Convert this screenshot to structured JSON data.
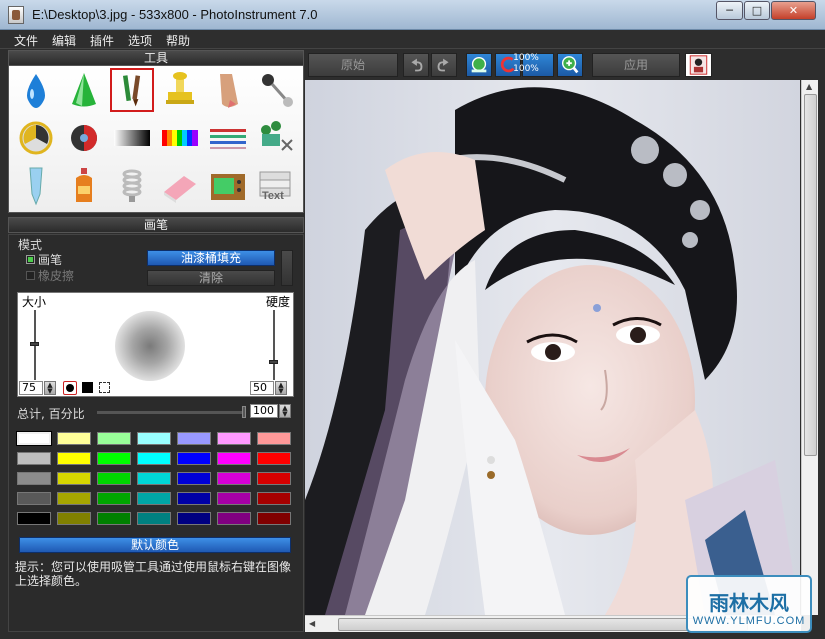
{
  "window": {
    "title": "E:\\Desktop\\3.jpg - 533x800 - PhotoInstrument 7.0",
    "min_glyph": "─",
    "max_glyph": "□",
    "close_glyph": "✕"
  },
  "menu": [
    "文件",
    "编辑",
    "插件",
    "选项",
    "帮助"
  ],
  "tools": {
    "header": "工具",
    "items": [
      {
        "name": "drop-blue",
        "color": "#1e7fd8"
      },
      {
        "name": "cone-green",
        "color": "#27b33a"
      },
      {
        "name": "brush-pencil",
        "color": "#2c8a38",
        "selected": true
      },
      {
        "name": "stamp-yellow",
        "color": "#e6c21f"
      },
      {
        "name": "finger-smudge",
        "color": "#d7a07c"
      },
      {
        "name": "pin-needle",
        "color": "#333333"
      },
      {
        "name": "radiation-badge",
        "color": "#e0b51f"
      },
      {
        "name": "eye-circle",
        "color": "#d22a2a"
      },
      {
        "name": "gradient-gray",
        "color": "#777777"
      },
      {
        "name": "rainbow-bars",
        "color": "#ff0000"
      },
      {
        "name": "lines-stripes",
        "color": "#cc3333"
      },
      {
        "name": "scissors-green",
        "color": "#2e8c3e"
      },
      {
        "name": "tube-blue",
        "color": "#9ad0f0"
      },
      {
        "name": "bottle-orange",
        "color": "#e67e1e"
      },
      {
        "name": "spring-white",
        "color": "#bbbbbb"
      },
      {
        "name": "eraser-pink",
        "color": "#f4a6b8"
      },
      {
        "name": "tv-box",
        "color": "#a06a2a"
      },
      {
        "name": "text-stack",
        "color": "#aaaaaa",
        "text": "Text"
      }
    ]
  },
  "brush": {
    "header": "画笔",
    "mode_label": "模式",
    "brush_label": "画笔",
    "eraser_label": "橡皮擦",
    "fill_button": "油漆桶填充",
    "clear_button": "清除",
    "size_label": "大小",
    "hardness_label": "硬度",
    "size_value": "75",
    "hardness_value": "50",
    "total_label": "总计, 百分比",
    "percent_value": "100",
    "percent_fraction": 0.98,
    "default_colors_button": "默认颜色",
    "hint": "提示：您可以使用吸管工具通过使用鼠标右键在图像上选择颜色。"
  },
  "swatches": [
    [
      "#ffffff",
      "#ffff99",
      "#99ff99",
      "#99ffff",
      "#9999ff",
      "#ff99ff",
      "#ff9999"
    ],
    [
      "#bfbfbf",
      "#ffff00",
      "#00ff00",
      "#00ffff",
      "#0000ff",
      "#ff00ff",
      "#ff0000"
    ],
    [
      "#8c8c8c",
      "#d6d600",
      "#00d600",
      "#00d6d6",
      "#0000d6",
      "#d600d6",
      "#d60000"
    ],
    [
      "#595959",
      "#a6a600",
      "#00a600",
      "#00a6a6",
      "#0000a6",
      "#a600a6",
      "#a60000"
    ],
    [
      "#000000",
      "#808000",
      "#008000",
      "#008080",
      "#000080",
      "#800080",
      "#800000"
    ]
  ],
  "toolbar": {
    "original_button": "原始",
    "apply_button": "应用",
    "zoom_top": "100%",
    "zoom_bottom": "100%"
  },
  "watermark": {
    "text": "雨林木风",
    "url": "WWW.YLMFU.COM"
  }
}
